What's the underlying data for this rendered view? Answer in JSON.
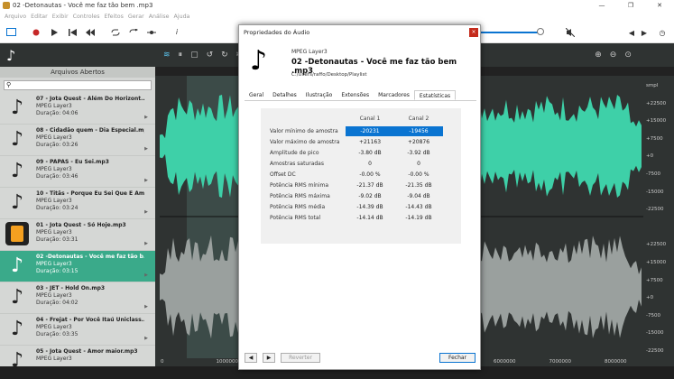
{
  "window": {
    "title": "02 -Detonautas - Você me faz tão bem .mp3",
    "min": "—",
    "max": "❐",
    "close": "✕"
  },
  "menu": [
    "Arquivo",
    "Editar",
    "Exibir",
    "Controles",
    "Efeitos",
    "Gerar",
    "Análise",
    "Ajuda"
  ],
  "toolbar": {
    "info": "i"
  },
  "left": {
    "header": "Arquivos Abertos",
    "search_placeholder": "",
    "items": [
      {
        "title": "07 - Jota Quest - Além Do Horizont...",
        "format": "MPEG Layer3",
        "duration": "Duração: 04:06",
        "art": "note-icon"
      },
      {
        "title": "08 - Cidadão quem - Dia Especial.mp3",
        "format": "MPEG Layer3",
        "duration": "Duração: 03:26",
        "art": "note-icon"
      },
      {
        "title": "09 - PAPAS - Eu Sei.mp3",
        "format": "MPEG Layer3",
        "duration": "Duração: 03:46",
        "art": "note-icon"
      },
      {
        "title": "10 - Titãs - Porque Eu Sei Que É Am...",
        "format": "MPEG Layer3",
        "duration": "Duração: 03:24",
        "art": "note-icon"
      },
      {
        "title": "01 - Jota Quest - Só Hoje.mp3",
        "format": "MPEG Layer3",
        "duration": "Duração: 03:31",
        "art": "album-art"
      },
      {
        "title": "02 -Detonautas - Você me faz tão b...",
        "format": "MPEG Layer3",
        "duration": "Duração: 03:15",
        "art": "note-icon",
        "selected": true
      },
      {
        "title": "03 - JET - Hold On.mp3",
        "format": "MPEG Layer3",
        "duration": "Duração: 04:02",
        "art": "note-icon"
      },
      {
        "title": "04 - Frejat - Por Você Itaú Uniclass....",
        "format": "MPEG Layer3",
        "duration": "Duração: 03:35",
        "art": "note-icon"
      },
      {
        "title": "05 - Jota Quest - Amor maior.mp3",
        "format": "MPEG Layer3",
        "duration": "",
        "art": "note-icon"
      }
    ]
  },
  "axis": [
    "smpl",
    "+22500",
    "+15000",
    "+7500",
    "+0",
    "-7500",
    "-15000",
    "-22500",
    "",
    "+22500",
    "+15000",
    "+7500",
    "+0",
    "-7500",
    "-15000",
    "-22500"
  ],
  "timeline": [
    "0",
    "1000000",
    "2000000",
    "3000000",
    "4000000",
    "5000000",
    "6000000",
    "7000000",
    "8000000"
  ],
  "dialog": {
    "title": "Propriedades do Áudio",
    "close": "×",
    "format": "MPEG Layer3",
    "filename": "02 -Detonautas - Você me faz tão bem .mp3",
    "path": "C:/Users/raffo/Desktop/Playlist",
    "tabs": [
      "Geral",
      "Detalhes",
      "Ilustração",
      "Extensões",
      "Marcadores",
      "Estatísticas"
    ],
    "active_tab": "Estatísticas",
    "columns": [
      "Canal 1",
      "Canal 2"
    ],
    "rows": [
      {
        "label": "Valor mínimo de amostra",
        "c1": "-20231",
        "c2": "-19456"
      },
      {
        "label": "Valor máximo de amostra",
        "c1": "+21163",
        "c2": "+20876"
      },
      {
        "label": "Amplitude de pico",
        "c1": "-3.80 dB",
        "c2": "-3.92 dB"
      },
      {
        "label": "Amostras saturadas",
        "c1": "0",
        "c2": "0"
      },
      {
        "label": "Offset DC",
        "c1": "-0.00 %",
        "c2": "-0.00 %"
      },
      {
        "label": "Potência RMS mínima",
        "c1": "-21.37 dB",
        "c2": "-21.35 dB"
      },
      {
        "label": "Potência RMS máxima",
        "c1": "-9.02 dB",
        "c2": "-9.04 dB"
      },
      {
        "label": "Potência RMS média",
        "c1": "-14.39 dB",
        "c2": "-14.43 dB"
      },
      {
        "label": "Potência RMS total",
        "c1": "-14.14 dB",
        "c2": "-14.19 dB"
      }
    ],
    "prev": "◀",
    "next": "▶",
    "revert": "Reverter",
    "ok": "Fechar"
  },
  "colors": {
    "accent": "#3aaa8a",
    "selection": "#0a74d1"
  }
}
